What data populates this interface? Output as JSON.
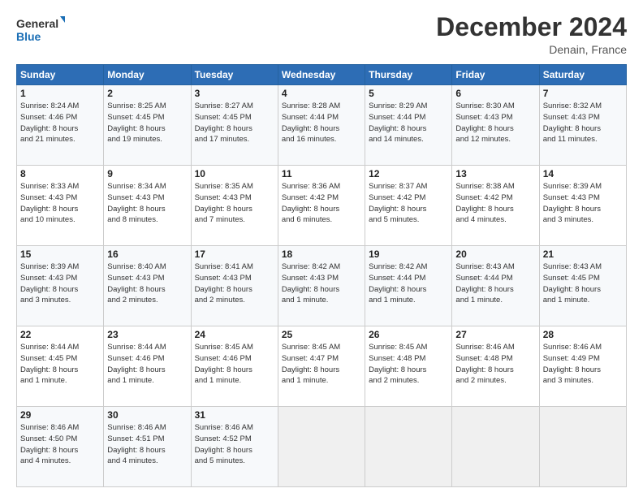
{
  "logo": {
    "line1": "General",
    "line2": "Blue"
  },
  "title": "December 2024",
  "location": "Denain, France",
  "days_header": [
    "Sunday",
    "Monday",
    "Tuesday",
    "Wednesday",
    "Thursday",
    "Friday",
    "Saturday"
  ],
  "weeks": [
    [
      {
        "day": "1",
        "lines": [
          "Sunrise: 8:24 AM",
          "Sunset: 4:46 PM",
          "Daylight: 8 hours",
          "and 21 minutes."
        ]
      },
      {
        "day": "2",
        "lines": [
          "Sunrise: 8:25 AM",
          "Sunset: 4:45 PM",
          "Daylight: 8 hours",
          "and 19 minutes."
        ]
      },
      {
        "day": "3",
        "lines": [
          "Sunrise: 8:27 AM",
          "Sunset: 4:45 PM",
          "Daylight: 8 hours",
          "and 17 minutes."
        ]
      },
      {
        "day": "4",
        "lines": [
          "Sunrise: 8:28 AM",
          "Sunset: 4:44 PM",
          "Daylight: 8 hours",
          "and 16 minutes."
        ]
      },
      {
        "day": "5",
        "lines": [
          "Sunrise: 8:29 AM",
          "Sunset: 4:44 PM",
          "Daylight: 8 hours",
          "and 14 minutes."
        ]
      },
      {
        "day": "6",
        "lines": [
          "Sunrise: 8:30 AM",
          "Sunset: 4:43 PM",
          "Daylight: 8 hours",
          "and 12 minutes."
        ]
      },
      {
        "day": "7",
        "lines": [
          "Sunrise: 8:32 AM",
          "Sunset: 4:43 PM",
          "Daylight: 8 hours",
          "and 11 minutes."
        ]
      }
    ],
    [
      {
        "day": "8",
        "lines": [
          "Sunrise: 8:33 AM",
          "Sunset: 4:43 PM",
          "Daylight: 8 hours",
          "and 10 minutes."
        ]
      },
      {
        "day": "9",
        "lines": [
          "Sunrise: 8:34 AM",
          "Sunset: 4:43 PM",
          "Daylight: 8 hours",
          "and 8 minutes."
        ]
      },
      {
        "day": "10",
        "lines": [
          "Sunrise: 8:35 AM",
          "Sunset: 4:43 PM",
          "Daylight: 8 hours",
          "and 7 minutes."
        ]
      },
      {
        "day": "11",
        "lines": [
          "Sunrise: 8:36 AM",
          "Sunset: 4:42 PM",
          "Daylight: 8 hours",
          "and 6 minutes."
        ]
      },
      {
        "day": "12",
        "lines": [
          "Sunrise: 8:37 AM",
          "Sunset: 4:42 PM",
          "Daylight: 8 hours",
          "and 5 minutes."
        ]
      },
      {
        "day": "13",
        "lines": [
          "Sunrise: 8:38 AM",
          "Sunset: 4:42 PM",
          "Daylight: 8 hours",
          "and 4 minutes."
        ]
      },
      {
        "day": "14",
        "lines": [
          "Sunrise: 8:39 AM",
          "Sunset: 4:43 PM",
          "Daylight: 8 hours",
          "and 3 minutes."
        ]
      }
    ],
    [
      {
        "day": "15",
        "lines": [
          "Sunrise: 8:39 AM",
          "Sunset: 4:43 PM",
          "Daylight: 8 hours",
          "and 3 minutes."
        ]
      },
      {
        "day": "16",
        "lines": [
          "Sunrise: 8:40 AM",
          "Sunset: 4:43 PM",
          "Daylight: 8 hours",
          "and 2 minutes."
        ]
      },
      {
        "day": "17",
        "lines": [
          "Sunrise: 8:41 AM",
          "Sunset: 4:43 PM",
          "Daylight: 8 hours",
          "and 2 minutes."
        ]
      },
      {
        "day": "18",
        "lines": [
          "Sunrise: 8:42 AM",
          "Sunset: 4:43 PM",
          "Daylight: 8 hours",
          "and 1 minute."
        ]
      },
      {
        "day": "19",
        "lines": [
          "Sunrise: 8:42 AM",
          "Sunset: 4:44 PM",
          "Daylight: 8 hours",
          "and 1 minute."
        ]
      },
      {
        "day": "20",
        "lines": [
          "Sunrise: 8:43 AM",
          "Sunset: 4:44 PM",
          "Daylight: 8 hours",
          "and 1 minute."
        ]
      },
      {
        "day": "21",
        "lines": [
          "Sunrise: 8:43 AM",
          "Sunset: 4:45 PM",
          "Daylight: 8 hours",
          "and 1 minute."
        ]
      }
    ],
    [
      {
        "day": "22",
        "lines": [
          "Sunrise: 8:44 AM",
          "Sunset: 4:45 PM",
          "Daylight: 8 hours",
          "and 1 minute."
        ]
      },
      {
        "day": "23",
        "lines": [
          "Sunrise: 8:44 AM",
          "Sunset: 4:46 PM",
          "Daylight: 8 hours",
          "and 1 minute."
        ]
      },
      {
        "day": "24",
        "lines": [
          "Sunrise: 8:45 AM",
          "Sunset: 4:46 PM",
          "Daylight: 8 hours",
          "and 1 minute."
        ]
      },
      {
        "day": "25",
        "lines": [
          "Sunrise: 8:45 AM",
          "Sunset: 4:47 PM",
          "Daylight: 8 hours",
          "and 1 minute."
        ]
      },
      {
        "day": "26",
        "lines": [
          "Sunrise: 8:45 AM",
          "Sunset: 4:48 PM",
          "Daylight: 8 hours",
          "and 2 minutes."
        ]
      },
      {
        "day": "27",
        "lines": [
          "Sunrise: 8:46 AM",
          "Sunset: 4:48 PM",
          "Daylight: 8 hours",
          "and 2 minutes."
        ]
      },
      {
        "day": "28",
        "lines": [
          "Sunrise: 8:46 AM",
          "Sunset: 4:49 PM",
          "Daylight: 8 hours",
          "and 3 minutes."
        ]
      }
    ],
    [
      {
        "day": "29",
        "lines": [
          "Sunrise: 8:46 AM",
          "Sunset: 4:50 PM",
          "Daylight: 8 hours",
          "and 4 minutes."
        ]
      },
      {
        "day": "30",
        "lines": [
          "Sunrise: 8:46 AM",
          "Sunset: 4:51 PM",
          "Daylight: 8 hours",
          "and 4 minutes."
        ]
      },
      {
        "day": "31",
        "lines": [
          "Sunrise: 8:46 AM",
          "Sunset: 4:52 PM",
          "Daylight: 8 hours",
          "and 5 minutes."
        ]
      },
      null,
      null,
      null,
      null
    ]
  ]
}
